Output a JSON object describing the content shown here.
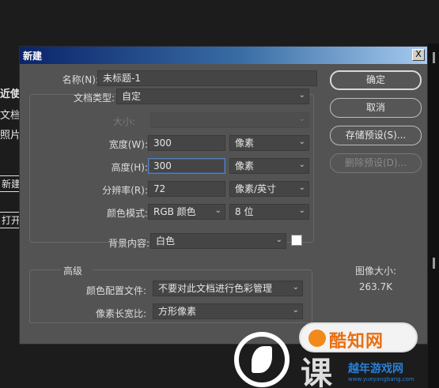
{
  "background": {
    "labels": [
      "近使",
      "文档",
      "照片"
    ],
    "buttons": [
      "新建",
      "打开"
    ]
  },
  "dialog": {
    "title": "新建",
    "close_label": "X",
    "name_label": "名称(N):",
    "name_value": "未标题-1",
    "preset_label": "文档类型:",
    "preset_value": "自定",
    "size_label": "大小:",
    "width_label": "宽度(W):",
    "width_value": "300",
    "width_unit": "像素",
    "height_label": "高度(H):",
    "height_value": "300",
    "height_unit": "像素",
    "resolution_label": "分辨率(R):",
    "resolution_value": "72",
    "resolution_unit": "像素/英寸",
    "color_mode_label": "颜色模式:",
    "color_mode_value": "RGB 颜色",
    "bit_depth_value": "8 位",
    "background_label": "背景内容:",
    "background_value": "白色",
    "advanced_label": "高级",
    "color_profile_label": "颜色配置文件:",
    "color_profile_value": "不要对此文档进行色彩管理",
    "pixel_aspect_label": "像素长宽比:",
    "pixel_aspect_value": "方形像素",
    "buttons": {
      "ok": "确定",
      "cancel": "取消",
      "save_preset": "存储预设(S)...",
      "delete_preset": "删除预设(D)..."
    },
    "image_size_label": "图像大小:",
    "image_size_value": "263.7K"
  },
  "watermark": {
    "pill_text": "酷知网",
    "big_text": "课",
    "site_name": "越年游戏网",
    "site_url": "www.yueyangbang.com"
  }
}
